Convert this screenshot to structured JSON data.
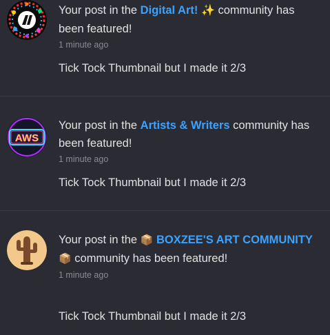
{
  "notifications": [
    {
      "prefix": "Your post in the",
      "community": "Digital Art!",
      "community_emoji": "✨",
      "suffix": "community has been featured!",
      "time": "1 minute ago",
      "body": "Tick Tock Thumbnail but I made it 2/3",
      "avatar_icon": "digital-art-logo"
    },
    {
      "prefix": "Your post in the",
      "community": "Artists & Writers",
      "suffix": "community has been featured!",
      "time": "1 minute ago",
      "body": "Tick Tock Thumbnail but I made it 2/3",
      "avatar_icon": "aws-neon-logo",
      "avatar_text": "AWS"
    },
    {
      "prefix": "Your post in the",
      "community_emoji_before": "📦",
      "community": "BOXZEE'S ART COMMUNITY",
      "community_emoji_after": "📦",
      "suffix": "community has been featured!",
      "time": "1 minute ago",
      "body": "Tick Tock Thumbnail but I made it 2/3",
      "avatar_icon": "cactus-logo"
    }
  ],
  "colors": {
    "background": "#2b2b33",
    "link": "#3ba3ff",
    "divider": "#3a3a44",
    "muted": "#8a8a95"
  }
}
